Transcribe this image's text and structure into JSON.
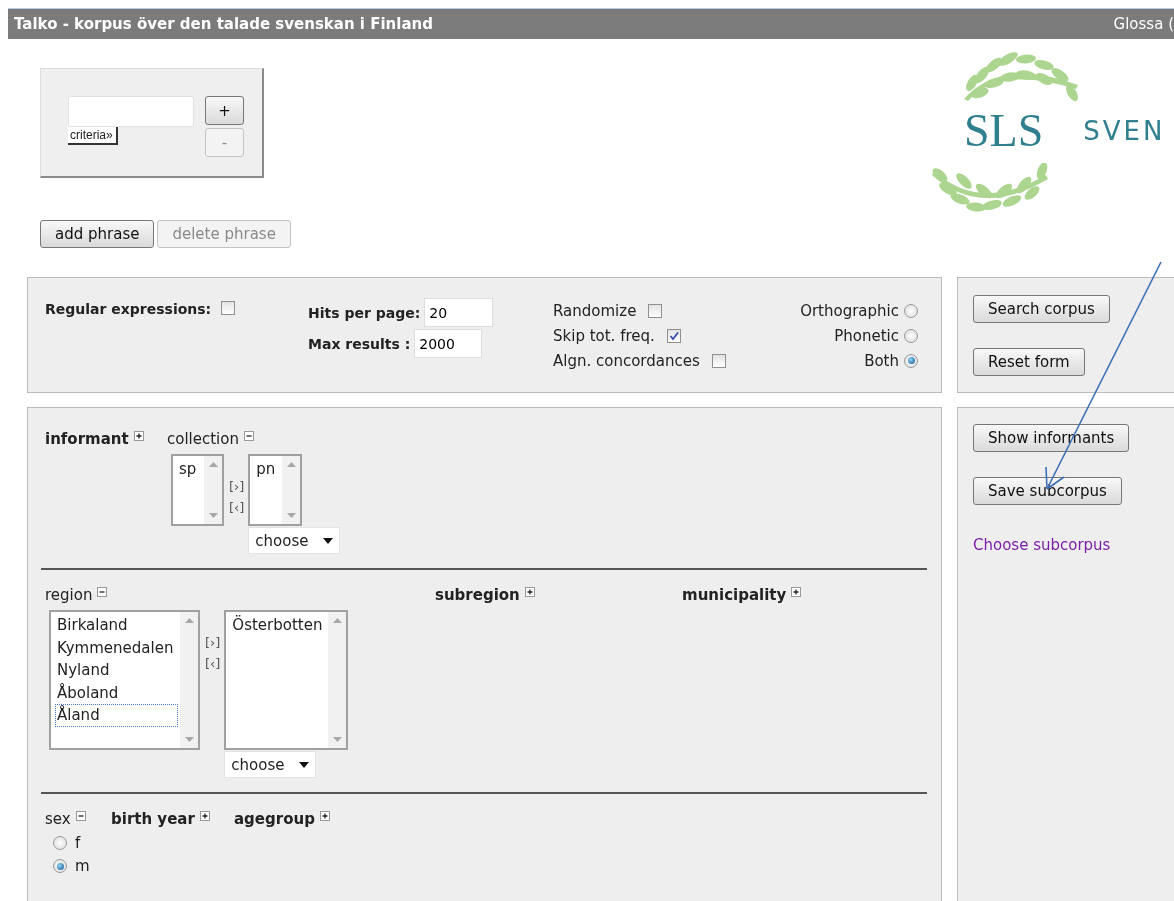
{
  "header": {
    "title": "Talko - korpus över den talade svenskan i Finland",
    "right_text": "Glossa ("
  },
  "query": {
    "criteria_label": "criteria»",
    "add_label": "+",
    "remove_label": "-",
    "remove_disabled": true
  },
  "logo": {
    "mark": "SLS",
    "name": "SVEN"
  },
  "phrase_buttons": [
    {
      "label": "add phrase",
      "disabled": false
    },
    {
      "label": "delete phrase",
      "disabled": true
    }
  ],
  "options": {
    "regex": {
      "label": "Regular expressions:",
      "checked": false
    },
    "hits_per_page": {
      "label": "Hits per page:",
      "value": "20"
    },
    "max_results": {
      "label": "Max results :",
      "value": "2000"
    },
    "flags": [
      {
        "label": "Randomize",
        "checked": false
      },
      {
        "label": "Skip tot. freq.",
        "checked": true
      },
      {
        "label": "Algn. concordances",
        "checked": false
      }
    ],
    "transcription": [
      {
        "label": "Orthographic",
        "selected": false
      },
      {
        "label": "Phonetic",
        "selected": false
      },
      {
        "label": "Both",
        "selected": true
      }
    ]
  },
  "search_actions": [
    "Search corpus",
    "Reset form"
  ],
  "subcorpus": {
    "buttons": [
      "Show informants",
      "Save subcorpus"
    ],
    "link": "Choose subcorpus"
  },
  "criteria": {
    "sections": [
      {
        "fields": [
          {
            "label": "informant",
            "expanded": false,
            "kind": "header"
          },
          {
            "label": "collection",
            "expanded": true,
            "kind": "lists",
            "available": [
              {
                "text": "sp",
                "focused": false
              }
            ],
            "chosen": [
              {
                "text": "pn"
              }
            ],
            "move_right": "[›]",
            "move_left": "[‹]",
            "choose": "choose"
          }
        ]
      },
      {
        "fields": [
          {
            "label": "region",
            "expanded": true,
            "kind": "lists",
            "available": [
              {
                "text": "Birkaland",
                "focused": false
              },
              {
                "text": "Kymmenedalen",
                "focused": false
              },
              {
                "text": "Nyland",
                "focused": false
              },
              {
                "text": "Åboland",
                "focused": false
              },
              {
                "text": "Åland",
                "focused": true
              }
            ],
            "chosen": [
              {
                "text": "Österbotten"
              }
            ],
            "move_right": "[›]",
            "move_left": "[‹]",
            "choose": "choose"
          },
          {
            "label": "subregion",
            "expanded": false,
            "kind": "header"
          },
          {
            "label": "municipality",
            "expanded": false,
            "kind": "header"
          }
        ]
      },
      {
        "fields": [
          {
            "label": "sex",
            "expanded": true,
            "kind": "radios",
            "options": [
              {
                "label": "f",
                "selected": false
              },
              {
                "label": "m",
                "selected": true
              }
            ]
          },
          {
            "label": "birth year",
            "expanded": false,
            "kind": "header"
          },
          {
            "label": "agegroup",
            "expanded": false,
            "kind": "header"
          }
        ]
      }
    ]
  }
}
